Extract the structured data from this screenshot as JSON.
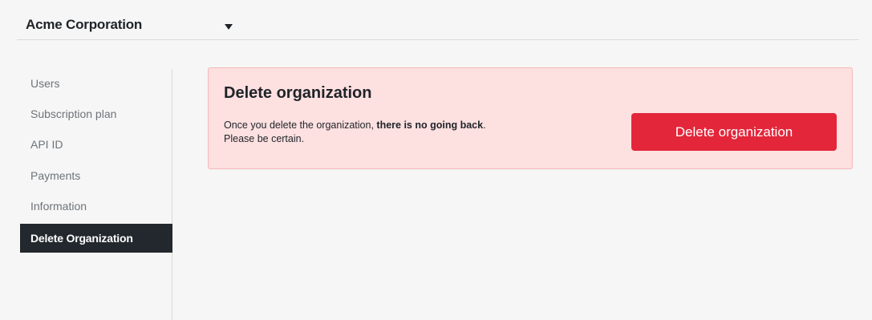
{
  "org_selector": {
    "name": "Acme Corporation",
    "icon": "caret-down-icon"
  },
  "sidebar": {
    "items": [
      {
        "label": "Users",
        "active": false
      },
      {
        "label": "Subscription plan",
        "active": false
      },
      {
        "label": "API ID",
        "active": false
      },
      {
        "label": "Payments",
        "active": false
      },
      {
        "label": "Information",
        "active": false
      },
      {
        "label": "Delete Organization",
        "active": true
      }
    ]
  },
  "danger_zone": {
    "title": "Delete organization",
    "text_intro": "Once you delete the organization, ",
    "text_emphasis": "there is no going back",
    "text_period": ".",
    "text_line2": "Please be certain.",
    "button_label": "Delete organization"
  },
  "colors": {
    "page_background": "#f6f6f6",
    "active_nav_background": "#22282d",
    "danger_panel_background": "#fde0e0",
    "danger_panel_border": "#f4b8ba",
    "danger_button": "#e3263a"
  }
}
